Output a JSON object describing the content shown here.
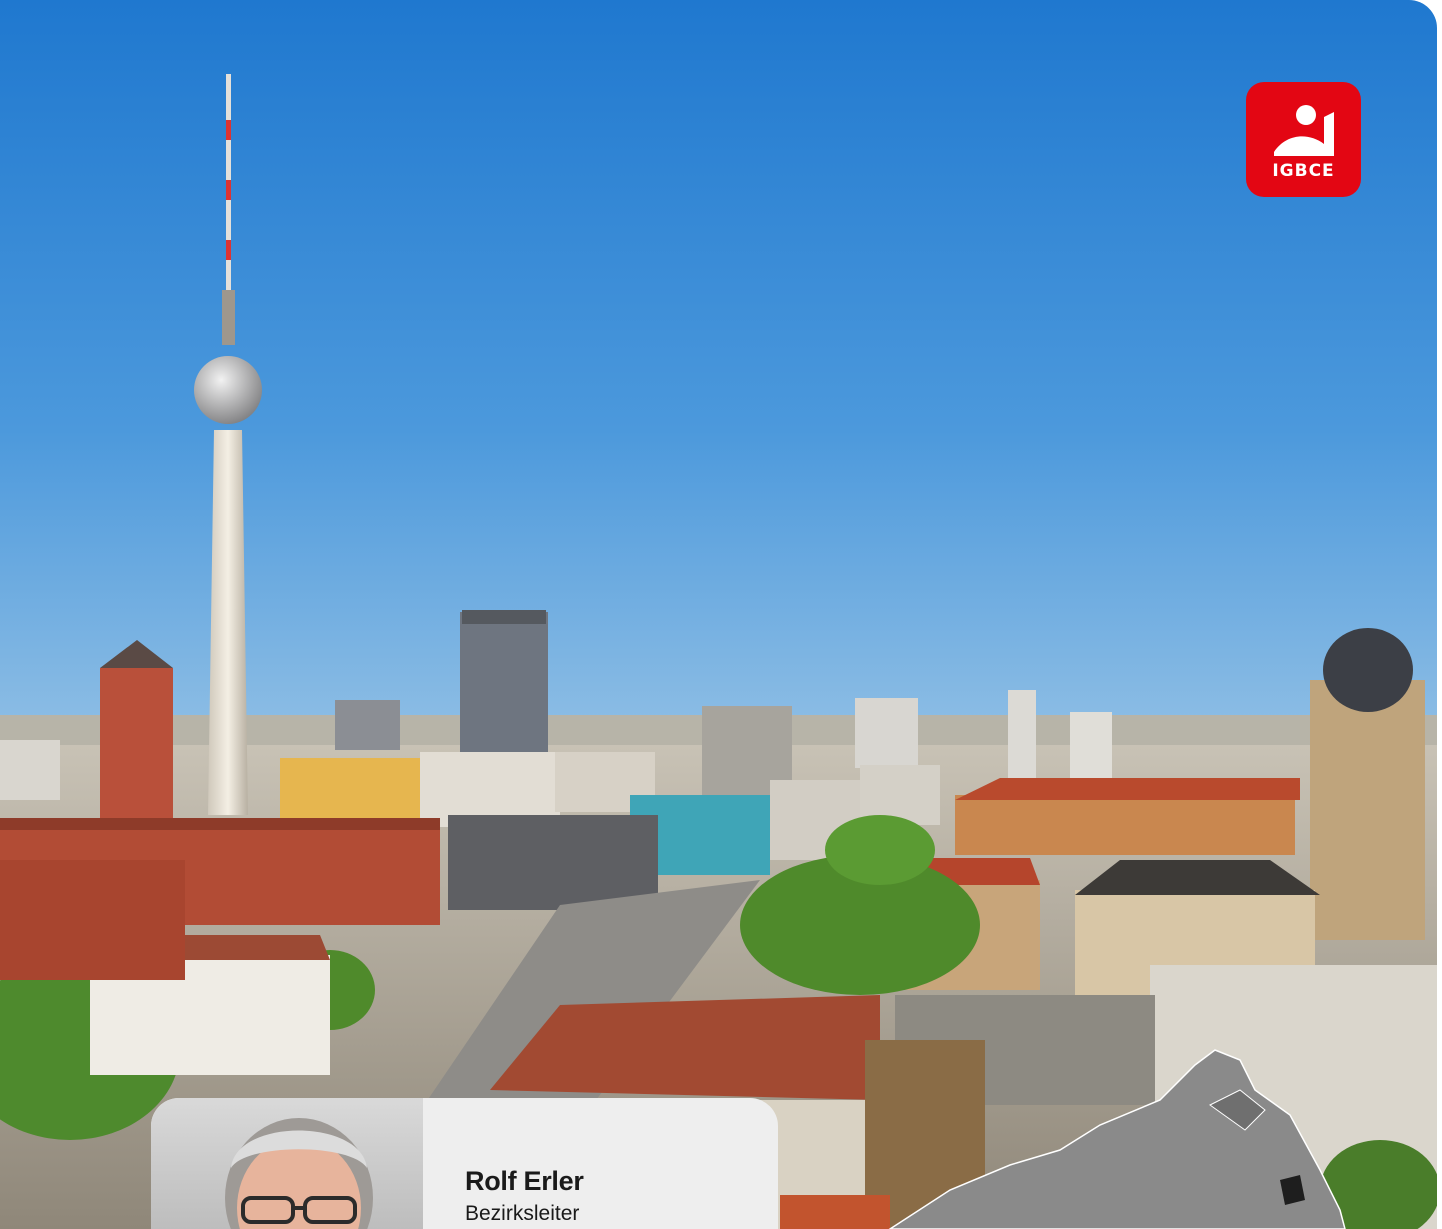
{
  "logo": {
    "text": "IGBCE",
    "icon": "igbce-figure-icon",
    "color": "#e30613"
  },
  "hero": {
    "image": "berlin-skyline-photo",
    "sky_top": "#2a7fd0",
    "sky_bottom": "#cfe2ee"
  },
  "contact": {
    "name": "Rolf Erler",
    "role": "Bezirksleiter",
    "portrait": "person-portrait"
  },
  "map": {
    "icon": "germany-region-map",
    "color": "#8a8a8a"
  }
}
